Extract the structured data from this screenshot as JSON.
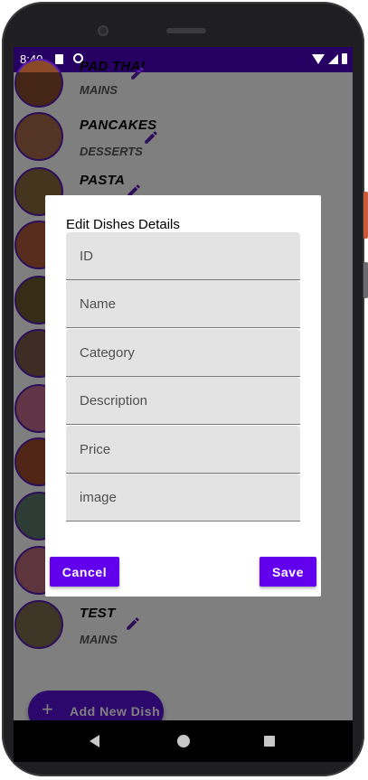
{
  "status_bar": {
    "time": "8:40"
  },
  "dishes": [
    {
      "name": "PAD THAI",
      "category": "MAINS",
      "thumb_color": "#8a4a2a"
    },
    {
      "name": "PANCAKES",
      "category": "DESSERTS",
      "thumb_color": "#a86a4a"
    },
    {
      "name": "PASTA",
      "category": "",
      "thumb_color": "#8c6a3c"
    },
    {
      "name": "",
      "category": "",
      "thumb_color": "#b05a3a"
    },
    {
      "name": "",
      "category": "",
      "thumb_color": "#6b5a2a"
    },
    {
      "name": "",
      "category": "",
      "thumb_color": "#7a5a4a"
    },
    {
      "name": "",
      "category": "",
      "thumb_color": "#c26a8a"
    },
    {
      "name": "",
      "category": "",
      "thumb_color": "#a04a2a"
    },
    {
      "name": "",
      "category": "",
      "thumb_color": "#5a7a6a"
    },
    {
      "name": "",
      "category": "",
      "thumb_color": "#b86a7a"
    },
    {
      "name": "TEST",
      "category": "MAINS",
      "thumb_color": "#7a6a4a"
    }
  ],
  "fab": {
    "label": "Add New Dish",
    "icon": "plus-icon"
  },
  "dialog": {
    "title": "Edit Dishes Details",
    "fields": {
      "id": {
        "placeholder": "ID",
        "value": ""
      },
      "name": {
        "placeholder": "Name",
        "value": ""
      },
      "category": {
        "placeholder": "Category",
        "value": ""
      },
      "description": {
        "placeholder": "Description",
        "value": ""
      },
      "price": {
        "placeholder": "Price",
        "value": ""
      },
      "image": {
        "placeholder": "image",
        "value": ""
      }
    },
    "cancel_label": "Cancel",
    "save_label": "Save"
  },
  "colors": {
    "primary": "#6200ee",
    "status_bar": "#260063",
    "accent_icon": "#5a1fb3"
  },
  "nav_bar": {
    "back": "back-icon",
    "home": "home-icon",
    "recents": "recents-icon"
  }
}
